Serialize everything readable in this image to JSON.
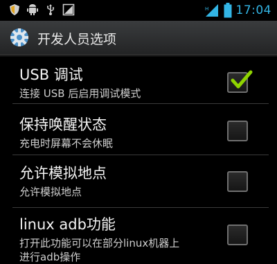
{
  "status_bar": {
    "time": "17:04",
    "icons": [
      "shield-icon",
      "android-debug-icon",
      "usb-icon",
      "screenshot-icon",
      "signal-icon",
      "battery-icon"
    ]
  },
  "action_bar": {
    "title": "开发人员选项",
    "icon": "settings-gear-icon"
  },
  "settings": [
    {
      "title": "USB 调试",
      "summary": "连接 USB 后启用调试模式",
      "checked": true
    },
    {
      "title": "保持唤醒状态",
      "summary": "充电时屏幕不会休眠",
      "checked": false
    },
    {
      "title": "允许模拟地点",
      "summary": "允许模拟地点",
      "checked": false
    },
    {
      "title": "linux adb功能",
      "summary": "打开此功能可以在部分linux机器上",
      "summary_cont": "进行adb操作",
      "checked": false
    }
  ],
  "colors": {
    "accent": "#33b5e5",
    "checkmark": "#8fd400",
    "background": "#000000"
  }
}
